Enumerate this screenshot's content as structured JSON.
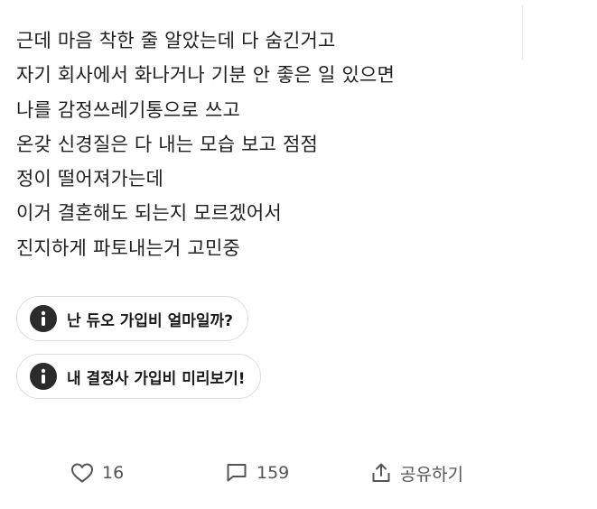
{
  "post": {
    "lines": [
      "근데 마음 착한 줄 알았는데 다 숨긴거고",
      "자기 회사에서 화나거나 기분 안 좋은 일 있으면",
      "나를 감정쓰레기통으로 쓰고",
      "온갖 신경질은 다 내는 모습 보고 점점",
      "정이 떨어져가는데",
      "이거 결혼해도 되는지 모르겠어서",
      "진지하게 파토내는거 고민중"
    ]
  },
  "chips": [
    {
      "label": "난 듀오 가입비 얼마일까?",
      "icon": "info-icon"
    },
    {
      "label": "내 결정사 가입비 미리보기!",
      "icon": "info-icon"
    }
  ],
  "actions": {
    "like_count": "16",
    "comment_count": "159",
    "share_label": "공유하기"
  },
  "colors": {
    "text": "#1f1f1f",
    "chip_border": "#dcdcdc",
    "icon_fill": "#2b2b2b",
    "action_gray": "#555555"
  }
}
